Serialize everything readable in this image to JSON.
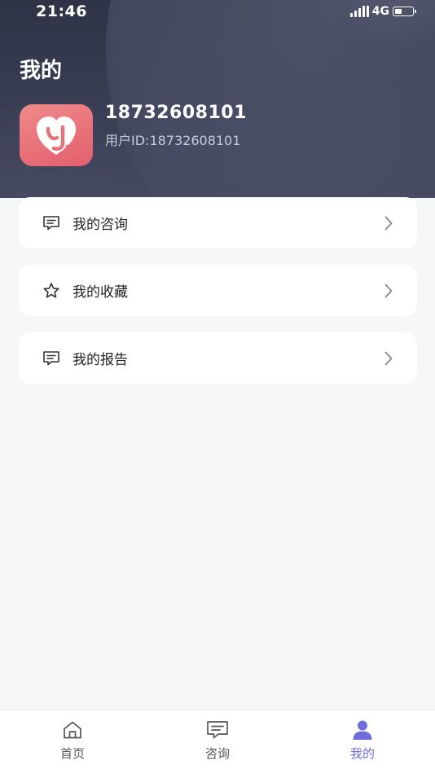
{
  "status_bar": {
    "time": "21:46",
    "network": "4G",
    "battery_level": 0.4
  },
  "page": {
    "title": "我的"
  },
  "profile": {
    "name": "18732608101",
    "user_id_label": "用户ID:",
    "user_id": "18732608101",
    "avatar_icon": "heart-y-logo"
  },
  "menu": [
    {
      "label": "我的咨询",
      "icon": "message-icon"
    },
    {
      "label": "我的收藏",
      "icon": "star-icon"
    },
    {
      "label": "我的报告",
      "icon": "message-icon"
    }
  ],
  "tab_bar": {
    "tabs": [
      {
        "label": "首页",
        "icon": "home-icon",
        "active": false
      },
      {
        "label": "咨询",
        "icon": "chat-icon",
        "active": false
      },
      {
        "label": "我的",
        "icon": "user-icon",
        "active": true
      }
    ]
  },
  "colors": {
    "header_bg": "#3a3f55",
    "accent": "#6f6cdc",
    "avatar_bg": "#e8727a",
    "page_bg": "#f6f7f9"
  }
}
